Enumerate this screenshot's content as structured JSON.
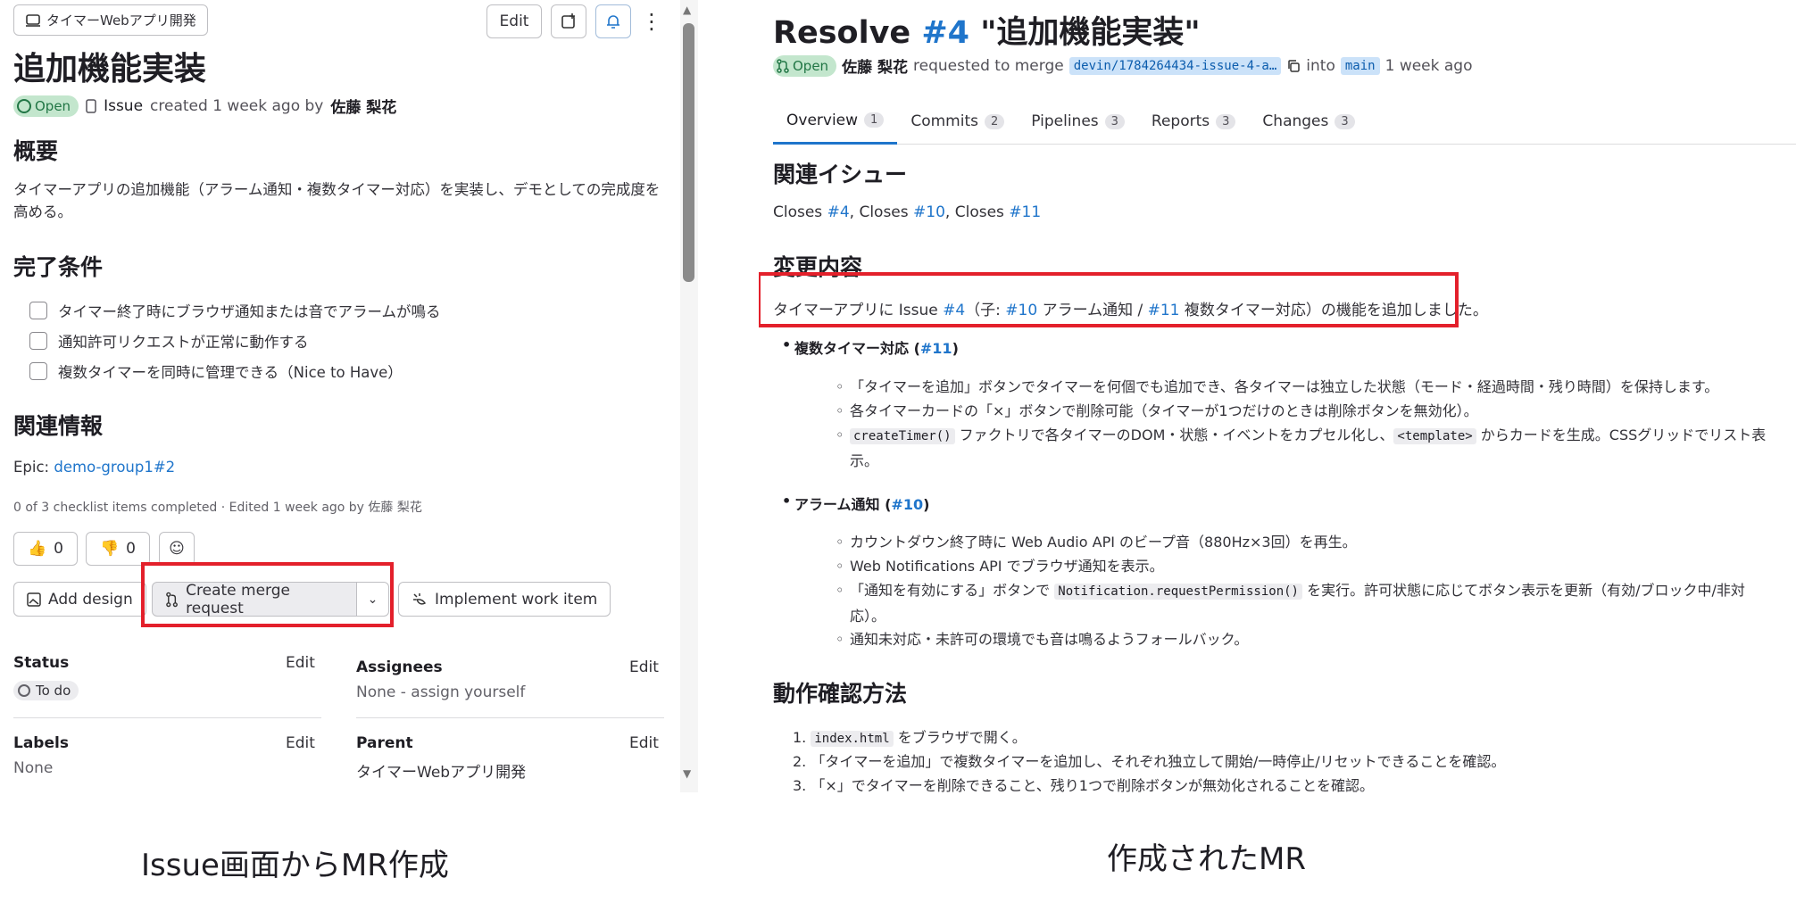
{
  "left": {
    "context": "タイマーWebアプリ開発",
    "top_buttons": {
      "edit": "Edit"
    },
    "title": "追加機能実装",
    "meta": {
      "status": "Open",
      "type": "Issue",
      "created": "created 1 week ago by",
      "author": "佐藤 梨花"
    },
    "overview": {
      "heading": "概要",
      "text": "タイマーアプリの追加機能（アラーム通知・複数タイマー対応）を実装し、デモとしての完成度を高める。"
    },
    "done": {
      "heading": "完了条件",
      "items": [
        "タイマー終了時にブラウザ通知または音でアラームが鳴る",
        "通知許可リクエストが正常に動作する",
        "複数タイマーを同時に管理できる（Nice to Have）"
      ]
    },
    "related": {
      "heading": "関連情報",
      "epic_label": "Epic:",
      "epic_link": "demo-group1#2"
    },
    "checklist_meta": "0 of 3 checklist items completed · Edited 1 week ago by 佐藤 梨花",
    "reactions": {
      "thumbs_up": "0",
      "thumbs_down": "0"
    },
    "actions": {
      "add_design": "Add design",
      "create_mr": "Create merge request",
      "implement": "Implement work item"
    },
    "sidebar": {
      "status_label": "Status",
      "status_value": "To do",
      "assignees_label": "Assignees",
      "assignees_value": "None - assign yourself",
      "labels_label": "Labels",
      "labels_value": "None",
      "parent_label": "Parent",
      "parent_value": "タイマーWebアプリ開発",
      "edit": "Edit"
    }
  },
  "right": {
    "title_prefix": "Resolve",
    "title_ref": "#4",
    "title_suffix": "\"追加機能実装\"",
    "meta": {
      "status": "Open",
      "author": "佐藤 梨花",
      "requested": "requested to merge",
      "source_branch": "devin/1784264434-issue-4-a…",
      "into": "into",
      "target_branch": "main",
      "time": "1 week ago"
    },
    "tabs": [
      {
        "label": "Overview",
        "count": "1"
      },
      {
        "label": "Commits",
        "count": "2"
      },
      {
        "label": "Pipelines",
        "count": "3"
      },
      {
        "label": "Reports",
        "count": "3"
      },
      {
        "label": "Changes",
        "count": "3"
      }
    ],
    "related_heading": "関連イシュー",
    "closes": {
      "word": "Closes",
      "refs": [
        "#4",
        "#10",
        "#11"
      ]
    },
    "changes_heading": "変更内容",
    "changes_intro": {
      "a": "タイマーアプリに Issue",
      "ref1": "#4",
      "b": "（子:",
      "ref2": "#10",
      "c": "アラーム通知 /",
      "ref3": "#11",
      "d": "複数タイマー対応）の機能を追加しました。"
    },
    "multi": {
      "title": "複数タイマー対応 (",
      "ref": "#11",
      "close": ")",
      "items": [
        "「タイマーを追加」ボタンでタイマーを何個でも追加でき、各タイマーは独立した状態（モード・経過時間・残り時間）を保持します。",
        "各タイマーカードの「×」ボタンで削除可能（タイマーが1つだけのときは削除ボタンを無効化）。"
      ],
      "item3_code1": "createTimer()",
      "item3_a": "ファクトリで各タイマーのDOM・状態・イベントをカプセル化し、",
      "item3_code2": "<template>",
      "item3_b": "からカードを生成。CSSグリッドでリスト表示。"
    },
    "alarm": {
      "title": "アラーム通知 (",
      "ref": "#10",
      "close": ")",
      "items": [
        "カウントダウン終了時に Web Audio API のビープ音（880Hz×3回）を再生。",
        "Web Notifications API でブラウザ通知を表示。"
      ],
      "item3_a": "「通知を有効にする」ボタンで",
      "item3_code": "Notification.requestPermission()",
      "item3_b": "を実行。許可状態に応じてボタン表示を更新（有効/ブロック中/非対応）。",
      "item4": "通知未対応・未許可の環境でも音は鳴るようフォールバック。"
    },
    "verify_heading": "動作確認方法",
    "verify": {
      "item1_code": "index.html",
      "item1_text": "をブラウザで開く。",
      "item2": "「タイマーを追加」で複数タイマーを追加し、それぞれ独立して開始/一時停止/リセットできることを確認。",
      "item3": "「×」でタイマーを削除できること、残り1つで削除ボタンが無効化されることを確認。"
    }
  },
  "captions": {
    "left": "Issue画面からMR作成",
    "right": "作成されたMR"
  }
}
